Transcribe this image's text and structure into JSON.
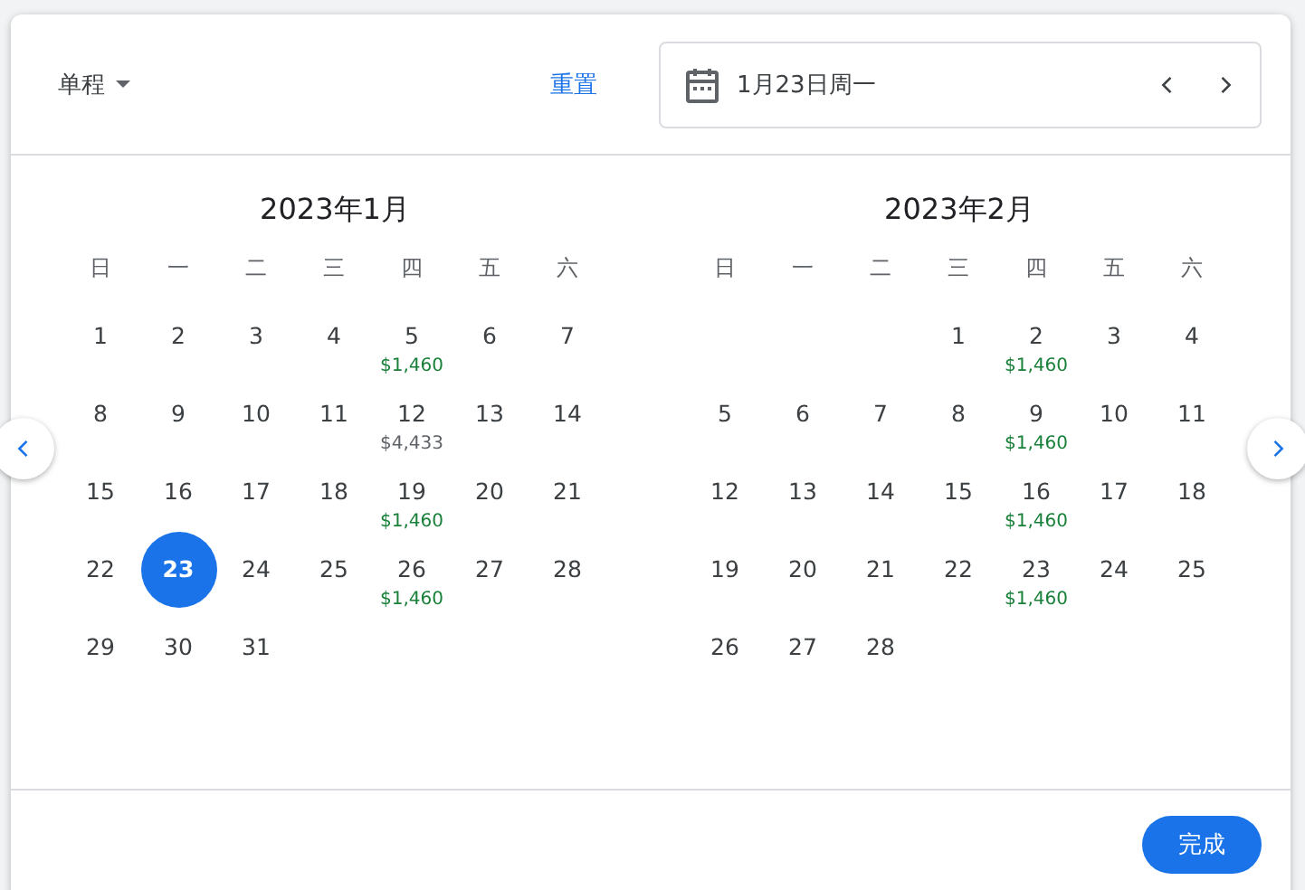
{
  "header": {
    "trip_type": "单程",
    "reset": "重置",
    "date_field": {
      "value": "1月23日周一"
    }
  },
  "months": [
    {
      "title": "2023年1月",
      "weekdays": [
        "日",
        "一",
        "二",
        "三",
        "四",
        "五",
        "六"
      ],
      "days": [
        {
          "kind": "day",
          "day": "1",
          "selected": false
        },
        {
          "kind": "day",
          "day": "2",
          "selected": false
        },
        {
          "kind": "day",
          "day": "3",
          "selected": false
        },
        {
          "kind": "day",
          "day": "4",
          "selected": false
        },
        {
          "kind": "day",
          "day": "5",
          "selected": false,
          "price": "$1,460",
          "color": "#188038"
        },
        {
          "kind": "day",
          "day": "6",
          "selected": false
        },
        {
          "kind": "day",
          "day": "7",
          "selected": false
        },
        {
          "kind": "day",
          "day": "8",
          "selected": false
        },
        {
          "kind": "day",
          "day": "9",
          "selected": false
        },
        {
          "kind": "day",
          "day": "10",
          "selected": false
        },
        {
          "kind": "day",
          "day": "11",
          "selected": false
        },
        {
          "kind": "day",
          "day": "12",
          "selected": false,
          "price": "$4,433",
          "color": "#5f6368"
        },
        {
          "kind": "day",
          "day": "13",
          "selected": false
        },
        {
          "kind": "day",
          "day": "14",
          "selected": false
        },
        {
          "kind": "day",
          "day": "15",
          "selected": false
        },
        {
          "kind": "day",
          "day": "16",
          "selected": false
        },
        {
          "kind": "day",
          "day": "17",
          "selected": false
        },
        {
          "kind": "day",
          "day": "18",
          "selected": false
        },
        {
          "kind": "day",
          "day": "19",
          "selected": false,
          "price": "$1,460",
          "color": "#188038"
        },
        {
          "kind": "day",
          "day": "20",
          "selected": false
        },
        {
          "kind": "day",
          "day": "21",
          "selected": false
        },
        {
          "kind": "day",
          "day": "22",
          "selected": false
        },
        {
          "kind": "day",
          "day": "23",
          "selected": true
        },
        {
          "kind": "day",
          "day": "24",
          "selected": false
        },
        {
          "kind": "day",
          "day": "25",
          "selected": false
        },
        {
          "kind": "day",
          "day": "26",
          "selected": false,
          "price": "$1,460",
          "color": "#188038"
        },
        {
          "kind": "day",
          "day": "27",
          "selected": false
        },
        {
          "kind": "day",
          "day": "28",
          "selected": false
        },
        {
          "kind": "day",
          "day": "29",
          "selected": false
        },
        {
          "kind": "day",
          "day": "30",
          "selected": false
        },
        {
          "kind": "day",
          "day": "31",
          "selected": false
        }
      ]
    },
    {
      "title": "2023年2月",
      "weekdays": [
        "日",
        "一",
        "二",
        "三",
        "四",
        "五",
        "六"
      ],
      "days": [
        {
          "kind": "blank"
        },
        {
          "kind": "blank"
        },
        {
          "kind": "blank"
        },
        {
          "kind": "day",
          "day": "1",
          "selected": false
        },
        {
          "kind": "day",
          "day": "2",
          "selected": false,
          "price": "$1,460",
          "color": "#188038"
        },
        {
          "kind": "day",
          "day": "3",
          "selected": false
        },
        {
          "kind": "day",
          "day": "4",
          "selected": false
        },
        {
          "kind": "day",
          "day": "5",
          "selected": false
        },
        {
          "kind": "day",
          "day": "6",
          "selected": false
        },
        {
          "kind": "day",
          "day": "7",
          "selected": false
        },
        {
          "kind": "day",
          "day": "8",
          "selected": false
        },
        {
          "kind": "day",
          "day": "9",
          "selected": false,
          "price": "$1,460",
          "color": "#188038"
        },
        {
          "kind": "day",
          "day": "10",
          "selected": false
        },
        {
          "kind": "day",
          "day": "11",
          "selected": false
        },
        {
          "kind": "day",
          "day": "12",
          "selected": false
        },
        {
          "kind": "day",
          "day": "13",
          "selected": false
        },
        {
          "kind": "day",
          "day": "14",
          "selected": false
        },
        {
          "kind": "day",
          "day": "15",
          "selected": false
        },
        {
          "kind": "day",
          "day": "16",
          "selected": false,
          "price": "$1,460",
          "color": "#188038"
        },
        {
          "kind": "day",
          "day": "17",
          "selected": false
        },
        {
          "kind": "day",
          "day": "18",
          "selected": false
        },
        {
          "kind": "day",
          "day": "19",
          "selected": false
        },
        {
          "kind": "day",
          "day": "20",
          "selected": false
        },
        {
          "kind": "day",
          "day": "21",
          "selected": false
        },
        {
          "kind": "day",
          "day": "22",
          "selected": false
        },
        {
          "kind": "day",
          "day": "23",
          "selected": false,
          "price": "$1,460",
          "color": "#188038"
        },
        {
          "kind": "day",
          "day": "24",
          "selected": false
        },
        {
          "kind": "day",
          "day": "25",
          "selected": false
        },
        {
          "kind": "day",
          "day": "26",
          "selected": false
        },
        {
          "kind": "day",
          "day": "27",
          "selected": false
        },
        {
          "kind": "day",
          "day": "28",
          "selected": false
        }
      ]
    }
  ],
  "footer": {
    "done_button": "完成"
  }
}
